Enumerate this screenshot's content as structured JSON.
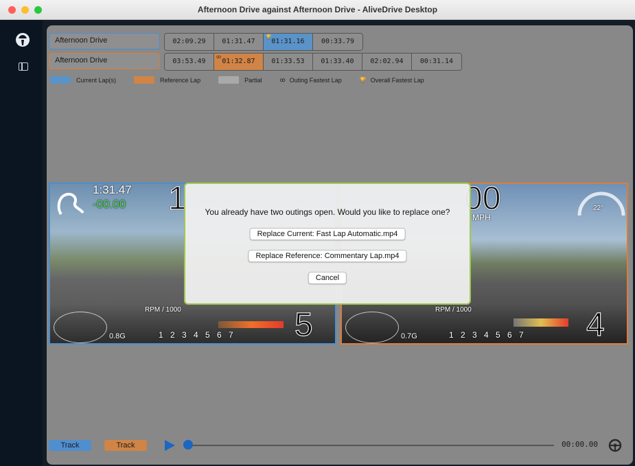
{
  "window": {
    "title": "Afternoon Drive against Afternoon Drive - AliveDrive Desktop"
  },
  "icons": {
    "logo": "alivedrive-logo-icon",
    "panel": "sidebar-panel-icon",
    "play": "play-icon",
    "wheel": "steering-wheel-icon"
  },
  "colors": {
    "current": "#5a93c8",
    "reference": "#d08446",
    "partial": "#a9a9a9",
    "modal_border": "#9ec94d",
    "play": "#1b66c2"
  },
  "outings": [
    {
      "name": "Afternoon Drive",
      "laps": [
        {
          "time": "02:09.29",
          "state": "normal",
          "mark": ""
        },
        {
          "time": "01:31.47",
          "state": "normal",
          "mark": ""
        },
        {
          "time": "01:31.16",
          "state": "current",
          "mark": "🏆"
        },
        {
          "time": "00:33.79",
          "state": "normal",
          "mark": ""
        }
      ]
    },
    {
      "name": "Afternoon Drive",
      "laps": [
        {
          "time": "03:53.49",
          "state": "normal",
          "mark": ""
        },
        {
          "time": "01:32.87",
          "state": "reference",
          "mark": "ꝏ"
        },
        {
          "time": "01:33.53",
          "state": "normal",
          "mark": ""
        },
        {
          "time": "01:33.40",
          "state": "normal",
          "mark": ""
        },
        {
          "time": "02:02.94",
          "state": "normal",
          "mark": ""
        },
        {
          "time": "00:31.14",
          "state": "normal",
          "mark": ""
        }
      ]
    }
  ],
  "legend": {
    "current": "Current Lap(s)",
    "reference": "Reference Lap",
    "partial": "Partial",
    "outing_fastest": "Outing Fastest Lap",
    "overall_fastest": "Overall Fastest Lap",
    "outing_symbol": "ꝏ",
    "overall_symbol": "🏆"
  },
  "videos": {
    "left": {
      "lap_time": "1:31.47",
      "delta": "-00.00",
      "rpm_label": "RPM / 1000",
      "gforce": "0.8G",
      "gear": "5",
      "rpm_ticks": "1 2 3 4 5 6 7",
      "speed_partial": "1"
    },
    "right": {
      "speed_partial": "00",
      "speed_unit": "MPH",
      "rpm_label": "RPM / 1000",
      "gforce": "0.7G",
      "gear": "4",
      "rpm_ticks": "1 2 3 4 5 6 7",
      "angle": "22°"
    }
  },
  "modal": {
    "message": "You already have two outings open. Would you like to replace one?",
    "replace_current": "Replace Current: Fast Lap Automatic.mp4",
    "replace_reference": "Replace Reference: Commentary Lap.mp4",
    "cancel": "Cancel"
  },
  "playback": {
    "track_left": "Track",
    "track_right": "Track",
    "time": "00:00.00",
    "progress": 0
  }
}
